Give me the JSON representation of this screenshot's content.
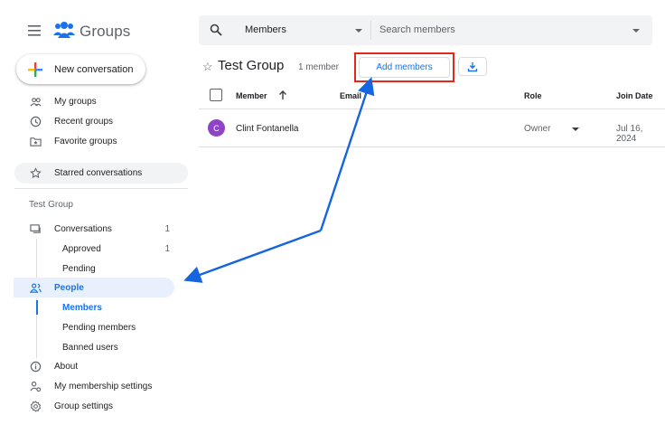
{
  "brand": {
    "title": "Groups",
    "menu_icon": "hamburger-menu-icon",
    "logo_icon": "groups-people-icon"
  },
  "compose": {
    "label": "New conversation",
    "icon": "multicolor-plus-icon"
  },
  "nav": {
    "my_groups": "My groups",
    "recent_groups": "Recent groups",
    "favorite_groups": "Favorite groups",
    "starred": "Starred conversations"
  },
  "group_nav": {
    "section_title": "Test Group",
    "conversations": {
      "label": "Conversations",
      "count": "1"
    },
    "approved": {
      "label": "Approved",
      "count": "1"
    },
    "pending": "Pending",
    "people": "People",
    "members": "Members",
    "pending_members": "Pending members",
    "banned_users": "Banned users",
    "about": "About",
    "membership_settings": "My membership settings",
    "group_settings": "Group settings"
  },
  "search": {
    "scope": "Members",
    "placeholder": "Search members"
  },
  "header": {
    "title": "Test Group",
    "member_count": "1 member",
    "add_members": "Add members"
  },
  "table": {
    "columns": {
      "member": "Member",
      "email": "Email",
      "role": "Role",
      "join_date": "Join Date"
    },
    "rows": [
      {
        "initial": "C",
        "name": "Clint Fontanella",
        "role": "Owner",
        "join_date": "Jul 16, 2024"
      }
    ]
  },
  "colors": {
    "accent": "#1a73e8",
    "highlight": "#e0281b",
    "arrow": "#1565e0",
    "avatar": "#8e44c5"
  }
}
